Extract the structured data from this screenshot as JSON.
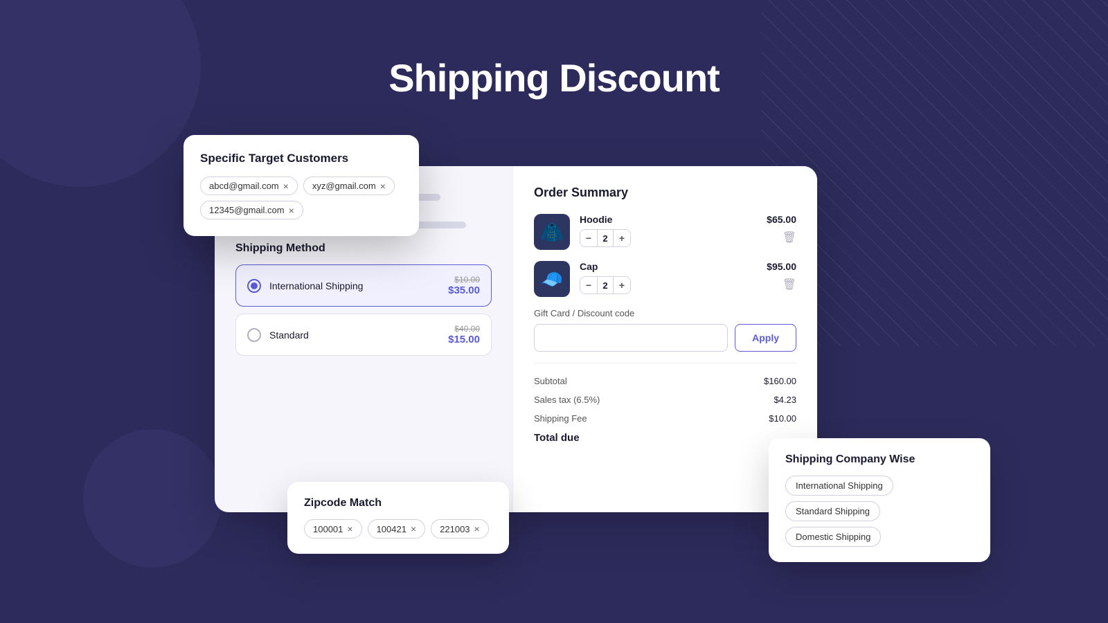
{
  "page": {
    "title": "Shipping Discount",
    "background": "#2d2b5b"
  },
  "target_customers_card": {
    "title": "Specific Target Customers",
    "emails": [
      {
        "value": "abcd@gmail.com"
      },
      {
        "value": "xyz@gmail.com"
      },
      {
        "value": "12345@gmail.com"
      }
    ]
  },
  "shipping_method": {
    "title": "Shipping Method",
    "options": [
      {
        "name": "International Shipping",
        "original_price": "$10.00",
        "discounted_price": "$35.00",
        "selected": true
      },
      {
        "name": "Standard",
        "original_price": "$40.00",
        "discounted_price": "$15.00",
        "selected": false
      }
    ]
  },
  "order_summary": {
    "title": "Order Summary",
    "items": [
      {
        "name": "Hoodie",
        "price": "$65.00",
        "quantity": 2
      },
      {
        "name": "Cap",
        "price": "$95.00",
        "quantity": 2
      }
    ],
    "discount_section": {
      "label": "Gift Card / Discount code",
      "input_placeholder": "",
      "apply_button": "Apply"
    },
    "totals": {
      "subtotal_label": "Subtotal",
      "subtotal_value": "$160.00",
      "tax_label": "Sales tax (6.5%)",
      "tax_value": "$4.23",
      "shipping_label": "Shipping Fee",
      "shipping_value": "$10.00",
      "total_label": "Total due",
      "total_value": ""
    }
  },
  "zipcode_card": {
    "title": "Zipcode Match",
    "zipcodes": [
      {
        "value": "100001"
      },
      {
        "value": "100421"
      },
      {
        "value": "221003"
      }
    ]
  },
  "shipping_company_card": {
    "title": "Shipping Company Wise",
    "tags": [
      {
        "value": "International Shipping"
      },
      {
        "value": "Standard Shipping"
      },
      {
        "value": "Domestic Shipping"
      }
    ]
  }
}
